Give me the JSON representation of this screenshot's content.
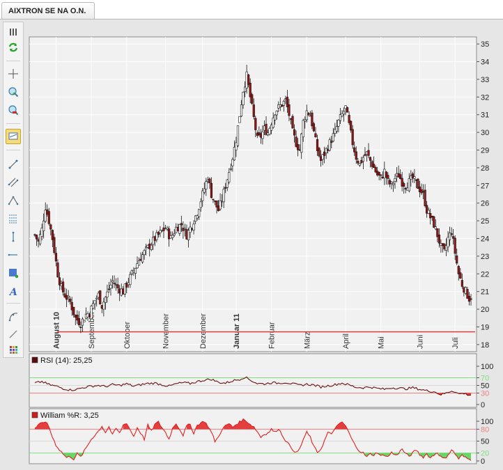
{
  "window": {
    "tab_title": "AIXTRON SE NA O.N."
  },
  "toolbar": {
    "tools": [
      {
        "name": "grip-icon"
      },
      {
        "name": "refresh-icon"
      },
      {
        "name": "crosshair-icon"
      },
      {
        "name": "zoom-in-icon"
      },
      {
        "name": "zoom-out-icon"
      },
      {
        "name": "indicator-icon"
      },
      {
        "name": "trendline-icon"
      },
      {
        "name": "channel-icon"
      },
      {
        "name": "triangle-icon"
      },
      {
        "name": "fibonacci-icon"
      },
      {
        "name": "vertical-line-icon"
      },
      {
        "name": "horizontal-line-icon"
      },
      {
        "name": "rectangle-icon"
      },
      {
        "name": "text-icon"
      },
      {
        "name": "arc-icon"
      },
      {
        "name": "pencil-icon"
      },
      {
        "name": "palette-icon"
      }
    ]
  },
  "chart_data": [
    {
      "type": "candlestick",
      "title": "",
      "ylim": [
        17.6,
        35.4
      ],
      "yticks": [
        18,
        19,
        20,
        21,
        22,
        23,
        24,
        25,
        26,
        27,
        28,
        29,
        30,
        31,
        32,
        33,
        34,
        35
      ],
      "xaxis_labels": [
        {
          "label": "August 10",
          "bold": true,
          "index": 12
        },
        {
          "label": "September",
          "bold": false,
          "index": 32
        },
        {
          "label": "Oktober",
          "bold": false,
          "index": 52
        },
        {
          "label": "November",
          "bold": false,
          "index": 74
        },
        {
          "label": "Dezember",
          "bold": false,
          "index": 95
        },
        {
          "label": "Januar 11",
          "bold": true,
          "index": 114
        },
        {
          "label": "Februar",
          "bold": false,
          "index": 134
        },
        {
          "label": "März",
          "bold": false,
          "index": 154
        },
        {
          "label": "April",
          "bold": false,
          "index": 176
        },
        {
          "label": "Mai",
          "bold": false,
          "index": 196
        },
        {
          "label": "Juni",
          "bold": false,
          "index": 218
        },
        {
          "label": "Juli",
          "bold": false,
          "index": 238
        }
      ],
      "anchors": [
        [
          0,
          24.2
        ],
        [
          2,
          23.8
        ],
        [
          4,
          24.5
        ],
        [
          6,
          25.8
        ],
        [
          8,
          25.0
        ],
        [
          10,
          24.0
        ],
        [
          13,
          22.0
        ],
        [
          15,
          21.2
        ],
        [
          17,
          20.8
        ],
        [
          20,
          20.4
        ],
        [
          23,
          19.5
        ],
        [
          26,
          19.2
        ],
        [
          29,
          19.7
        ],
        [
          31,
          19.8
        ],
        [
          34,
          20.5
        ],
        [
          36,
          20.8
        ],
        [
          38,
          20.2
        ],
        [
          41,
          20.9
        ],
        [
          44,
          21.6
        ],
        [
          47,
          21.2
        ],
        [
          50,
          21.0
        ],
        [
          53,
          21.6
        ],
        [
          56,
          22.2
        ],
        [
          59,
          22.8
        ],
        [
          62,
          23.2
        ],
        [
          65,
          23.6
        ],
        [
          68,
          24.0
        ],
        [
          71,
          24.3
        ],
        [
          74,
          24.6
        ],
        [
          77,
          24.0
        ],
        [
          80,
          24.6
        ],
        [
          83,
          24.8
        ],
        [
          86,
          24.2
        ],
        [
          89,
          24.8
        ],
        [
          92,
          25.5
        ],
        [
          95,
          26.5
        ],
        [
          98,
          27.5
        ],
        [
          100,
          26.5
        ],
        [
          102,
          26.0
        ],
        [
          104,
          25.6
        ],
        [
          106,
          26.2
        ],
        [
          108,
          27.0
        ],
        [
          110,
          27.8
        ],
        [
          112,
          28.6
        ],
        [
          114,
          29.6
        ],
        [
          116,
          31.0
        ],
        [
          118,
          32.4
        ],
        [
          120,
          33.2
        ],
        [
          122,
          32.0
        ],
        [
          124,
          30.8
        ],
        [
          126,
          29.6
        ],
        [
          128,
          29.8
        ],
        [
          130,
          30.2
        ],
        [
          132,
          30.0
        ],
        [
          134,
          30.6
        ],
        [
          136,
          31.2
        ],
        [
          138,
          31.4
        ],
        [
          140,
          31.6
        ],
        [
          142,
          31.8
        ],
        [
          144,
          31.0
        ],
        [
          146,
          30.0
        ],
        [
          148,
          29.4
        ],
        [
          150,
          29.0
        ],
        [
          152,
          30.6
        ],
        [
          154,
          31.2
        ],
        [
          156,
          31.0
        ],
        [
          158,
          30.0
        ],
        [
          160,
          29.0
        ],
        [
          162,
          28.4
        ],
        [
          164,
          28.8
        ],
        [
          166,
          29.2
        ],
        [
          168,
          29.6
        ],
        [
          170,
          30.0
        ],
        [
          172,
          30.6
        ],
        [
          174,
          31.0
        ],
        [
          176,
          31.4
        ],
        [
          178,
          30.4
        ],
        [
          180,
          29.4
        ],
        [
          182,
          28.6
        ],
        [
          184,
          28.2
        ],
        [
          186,
          28.6
        ],
        [
          188,
          28.8
        ],
        [
          190,
          28.4
        ],
        [
          192,
          28.0
        ],
        [
          194,
          27.6
        ],
        [
          196,
          27.4
        ],
        [
          198,
          27.8
        ],
        [
          200,
          27.2
        ],
        [
          202,
          27.0
        ],
        [
          204,
          27.4
        ],
        [
          206,
          27.6
        ],
        [
          208,
          27.2
        ],
        [
          210,
          27.0
        ],
        [
          212,
          27.2
        ],
        [
          214,
          27.4
        ],
        [
          216,
          27.1
        ],
        [
          218,
          26.8
        ],
        [
          220,
          26.5
        ],
        [
          222,
          25.6
        ],
        [
          224,
          25.2
        ],
        [
          226,
          24.8
        ],
        [
          228,
          24.2
        ],
        [
          230,
          23.5
        ],
        [
          232,
          23.2
        ],
        [
          234,
          24.0
        ],
        [
          236,
          24.4
        ],
        [
          238,
          23.2
        ],
        [
          240,
          22.0
        ],
        [
          242,
          21.4
        ],
        [
          244,
          21.0
        ],
        [
          246,
          20.6
        ],
        [
          247,
          20.7
        ]
      ],
      "support_line": {
        "value": 18.72,
        "color": "#e03030"
      }
    },
    {
      "type": "line",
      "title": "RSI (14): 25,25",
      "legend_color": "#5a0c0c",
      "line_color": "#6a1010",
      "ylim": [
        0,
        100
      ],
      "yticks": [
        0,
        30,
        50,
        70,
        100
      ],
      "levels": [
        {
          "value": 70,
          "color": "#7fe07f"
        },
        {
          "value": 50,
          "color": "#d9d9d9"
        },
        {
          "value": 30,
          "color": "#ef8080"
        }
      ],
      "anchors": [
        [
          0,
          56
        ],
        [
          4,
          60
        ],
        [
          8,
          52
        ],
        [
          12,
          48
        ],
        [
          16,
          42
        ],
        [
          20,
          38
        ],
        [
          24,
          40
        ],
        [
          28,
          45
        ],
        [
          32,
          48
        ],
        [
          36,
          50
        ],
        [
          40,
          47
        ],
        [
          44,
          52
        ],
        [
          48,
          50
        ],
        [
          52,
          54
        ],
        [
          56,
          48
        ],
        [
          60,
          52
        ],
        [
          64,
          55
        ],
        [
          68,
          56
        ],
        [
          72,
          52
        ],
        [
          76,
          48
        ],
        [
          80,
          54
        ],
        [
          84,
          57
        ],
        [
          88,
          55
        ],
        [
          92,
          60
        ],
        [
          96,
          64
        ],
        [
          100,
          66
        ],
        [
          104,
          58
        ],
        [
          108,
          56
        ],
        [
          112,
          62
        ],
        [
          116,
          66
        ],
        [
          119,
          72
        ],
        [
          122,
          64
        ],
        [
          126,
          55
        ],
        [
          130,
          54
        ],
        [
          134,
          57
        ],
        [
          138,
          56
        ],
        [
          142,
          58
        ],
        [
          146,
          54
        ],
        [
          150,
          50
        ],
        [
          154,
          53
        ],
        [
          158,
          51
        ],
        [
          162,
          46
        ],
        [
          166,
          49
        ],
        [
          170,
          52
        ],
        [
          174,
          56
        ],
        [
          178,
          51
        ],
        [
          182,
          45
        ],
        [
          186,
          44
        ],
        [
          190,
          46
        ],
        [
          194,
          42
        ],
        [
          198,
          40
        ],
        [
          202,
          44
        ],
        [
          206,
          43
        ],
        [
          210,
          41
        ],
        [
          214,
          44
        ],
        [
          218,
          40
        ],
        [
          222,
          36
        ],
        [
          226,
          34
        ],
        [
          230,
          26
        ],
        [
          233,
          30
        ],
        [
          236,
          36
        ],
        [
          238,
          34
        ],
        [
          240,
          28
        ],
        [
          243,
          29
        ],
        [
          246,
          25
        ]
      ]
    },
    {
      "type": "line",
      "title": "William %R: 3,25",
      "legend_color": "#cc1c1c",
      "line_color": "#e02020",
      "ylim": [
        0,
        100
      ],
      "yticks": [
        0,
        20,
        50,
        80,
        100
      ],
      "levels": [
        {
          "value": 80,
          "color": "#ef8080"
        },
        {
          "value": 50,
          "color": "#d9d9d9"
        },
        {
          "value": 20,
          "color": "#7fe07f"
        }
      ],
      "anchors": [
        [
          0,
          82
        ],
        [
          2,
          90
        ],
        [
          4,
          95
        ],
        [
          6,
          100
        ],
        [
          8,
          85
        ],
        [
          10,
          60
        ],
        [
          12,
          40
        ],
        [
          14,
          28
        ],
        [
          16,
          18
        ],
        [
          18,
          8
        ],
        [
          20,
          12
        ],
        [
          22,
          5
        ],
        [
          24,
          18
        ],
        [
          26,
          10
        ],
        [
          28,
          25
        ],
        [
          30,
          40
        ],
        [
          32,
          55
        ],
        [
          34,
          65
        ],
        [
          36,
          75
        ],
        [
          38,
          88
        ],
        [
          40,
          72
        ],
        [
          42,
          86
        ],
        [
          44,
          65
        ],
        [
          46,
          82
        ],
        [
          48,
          70
        ],
        [
          50,
          90
        ],
        [
          52,
          96
        ],
        [
          54,
          78
        ],
        [
          56,
          62
        ],
        [
          58,
          84
        ],
        [
          60,
          70
        ],
        [
          62,
          55
        ],
        [
          64,
          90
        ],
        [
          66,
          75
        ],
        [
          68,
          92
        ],
        [
          70,
          98
        ],
        [
          72,
          84
        ],
        [
          74,
          72
        ],
        [
          76,
          55
        ],
        [
          78,
          82
        ],
        [
          80,
          95
        ],
        [
          82,
          80
        ],
        [
          84,
          65
        ],
        [
          86,
          88
        ],
        [
          88,
          92
        ],
        [
          90,
          70
        ],
        [
          92,
          90
        ],
        [
          94,
          96
        ],
        [
          96,
          100
        ],
        [
          98,
          88
        ],
        [
          100,
          72
        ],
        [
          102,
          50
        ],
        [
          104,
          60
        ],
        [
          106,
          80
        ],
        [
          108,
          88
        ],
        [
          110,
          94
        ],
        [
          112,
          85
        ],
        [
          114,
          92
        ],
        [
          116,
          98
        ],
        [
          118,
          104
        ],
        [
          120,
          100
        ],
        [
          122,
          92
        ],
        [
          124,
          86
        ],
        [
          126,
          74
        ],
        [
          128,
          60
        ],
        [
          130,
          68
        ],
        [
          132,
          70
        ],
        [
          134,
          80
        ],
        [
          136,
          72
        ],
        [
          138,
          82
        ],
        [
          140,
          66
        ],
        [
          142,
          52
        ],
        [
          144,
          40
        ],
        [
          146,
          30
        ],
        [
          148,
          20
        ],
        [
          150,
          30
        ],
        [
          152,
          54
        ],
        [
          154,
          72
        ],
        [
          156,
          60
        ],
        [
          158,
          36
        ],
        [
          160,
          22
        ],
        [
          162,
          30
        ],
        [
          164,
          50
        ],
        [
          166,
          72
        ],
        [
          168,
          66
        ],
        [
          170,
          84
        ],
        [
          172,
          90
        ],
        [
          174,
          98
        ],
        [
          176,
          88
        ],
        [
          178,
          70
        ],
        [
          180,
          50
        ],
        [
          182,
          36
        ],
        [
          184,
          25
        ],
        [
          186,
          20
        ],
        [
          188,
          10
        ],
        [
          190,
          18
        ],
        [
          192,
          15
        ],
        [
          194,
          22
        ],
        [
          196,
          12
        ],
        [
          198,
          16
        ],
        [
          200,
          10
        ],
        [
          202,
          22
        ],
        [
          204,
          14
        ],
        [
          206,
          20
        ],
        [
          208,
          30
        ],
        [
          210,
          18
        ],
        [
          212,
          12
        ],
        [
          214,
          20
        ],
        [
          216,
          28
        ],
        [
          218,
          16
        ],
        [
          220,
          10
        ],
        [
          222,
          18
        ],
        [
          224,
          8
        ],
        [
          226,
          15
        ],
        [
          228,
          22
        ],
        [
          230,
          10
        ],
        [
          232,
          5
        ],
        [
          234,
          16
        ],
        [
          236,
          28
        ],
        [
          238,
          18
        ],
        [
          240,
          6
        ],
        [
          242,
          14
        ],
        [
          244,
          8
        ],
        [
          246,
          4
        ]
      ]
    }
  ]
}
